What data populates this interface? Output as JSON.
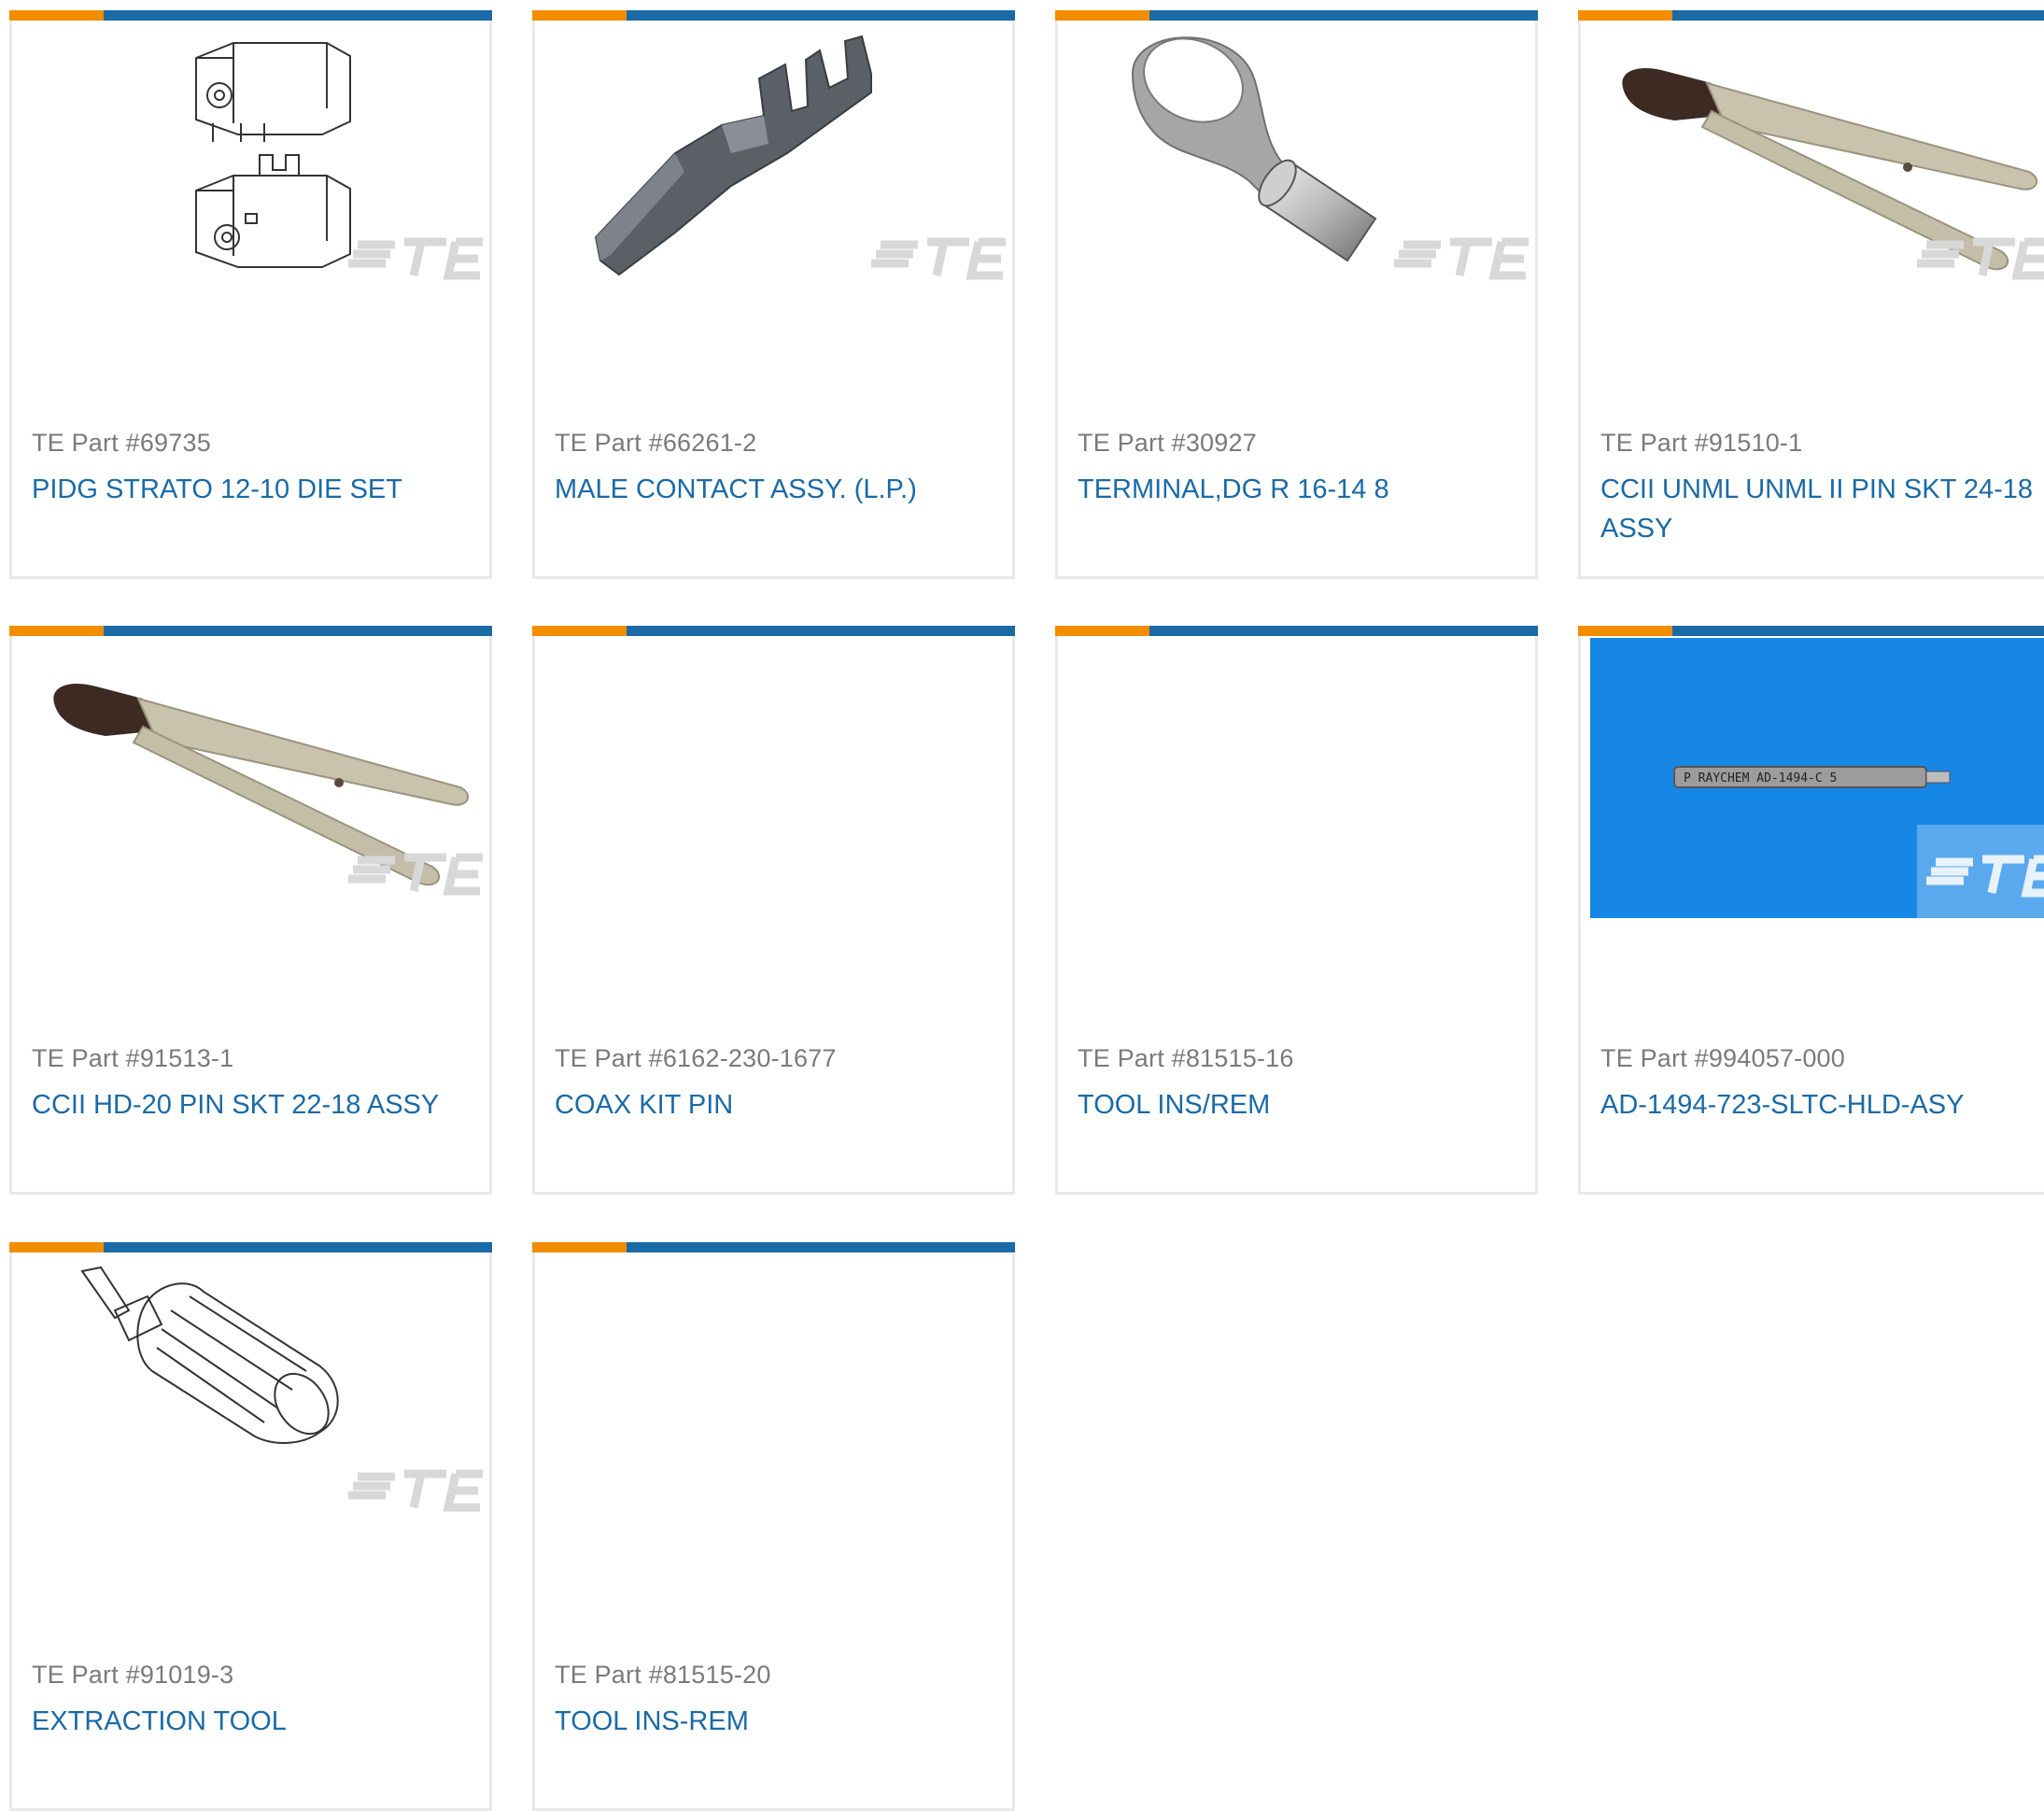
{
  "part_prefix": "TE Part #",
  "colors": {
    "accent_orange": "#f28d00",
    "accent_blue": "#1a6aa6",
    "label_gray": "#7a7a7a",
    "card_border": "#e9e9e9"
  },
  "products": [
    {
      "part_label": "TE Part #69735",
      "title": "PIDG STRATO 12-10 DIE SET",
      "image": "die-set-drawing"
    },
    {
      "part_label": "TE Part #66261-2",
      "title": "MALE CONTACT ASSY. (L.P.)",
      "image": "male-contact-render"
    },
    {
      "part_label": "TE Part #30927",
      "title": "TERMINAL,DG R 16-14 8",
      "image": "ring-terminal-render"
    },
    {
      "part_label": "TE Part #91510-1",
      "title": "CCII UNML UNML II PIN SKT 24-18 ASSY",
      "image": "crimp-tool-photo"
    },
    {
      "part_label": "TE Part #91513-1",
      "title": "CCII HD-20 PIN SKT 22-18 ASSY",
      "image": "crimp-tool-photo"
    },
    {
      "part_label": "TE Part #6162-230-1677",
      "title": "COAX KIT PIN",
      "image": "none"
    },
    {
      "part_label": "TE Part #81515-16",
      "title": "TOOL INS/REM",
      "image": "none"
    },
    {
      "part_label": "TE Part #994057-000",
      "title": "AD-1494-723-SLTC-HLD-ASY",
      "image": "tool-on-blue-photo",
      "image_text": "P RAYCHEM AD-1494-C 5"
    },
    {
      "part_label": "TE Part #91019-3",
      "title": "EXTRACTION TOOL",
      "image": "extraction-tool-drawing"
    },
    {
      "part_label": "TE Part #81515-20",
      "title": "TOOL INS-REM",
      "image": "none"
    }
  ]
}
